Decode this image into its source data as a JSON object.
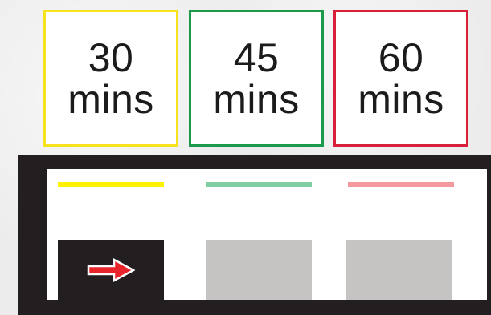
{
  "cards": [
    {
      "number": "30",
      "unit": "mins",
      "border_color": "#f7e21e"
    },
    {
      "number": "45",
      "unit": "mins",
      "border_color": "#1a9a4a"
    },
    {
      "number": "60",
      "unit": "mins",
      "border_color": "#d8203a"
    }
  ],
  "indicators": [
    {
      "color": "#fef200",
      "state": "active"
    },
    {
      "color": "#7fcfa5",
      "state": "inactive"
    },
    {
      "color": "#f4999e",
      "state": "inactive"
    }
  ],
  "active_slot": {
    "icon": "arrow-right-icon",
    "icon_color": "#e8252a"
  },
  "colors": {
    "panel": "#231f20",
    "slot_empty": "#c5c4c3",
    "card_background": "#ffffff"
  }
}
